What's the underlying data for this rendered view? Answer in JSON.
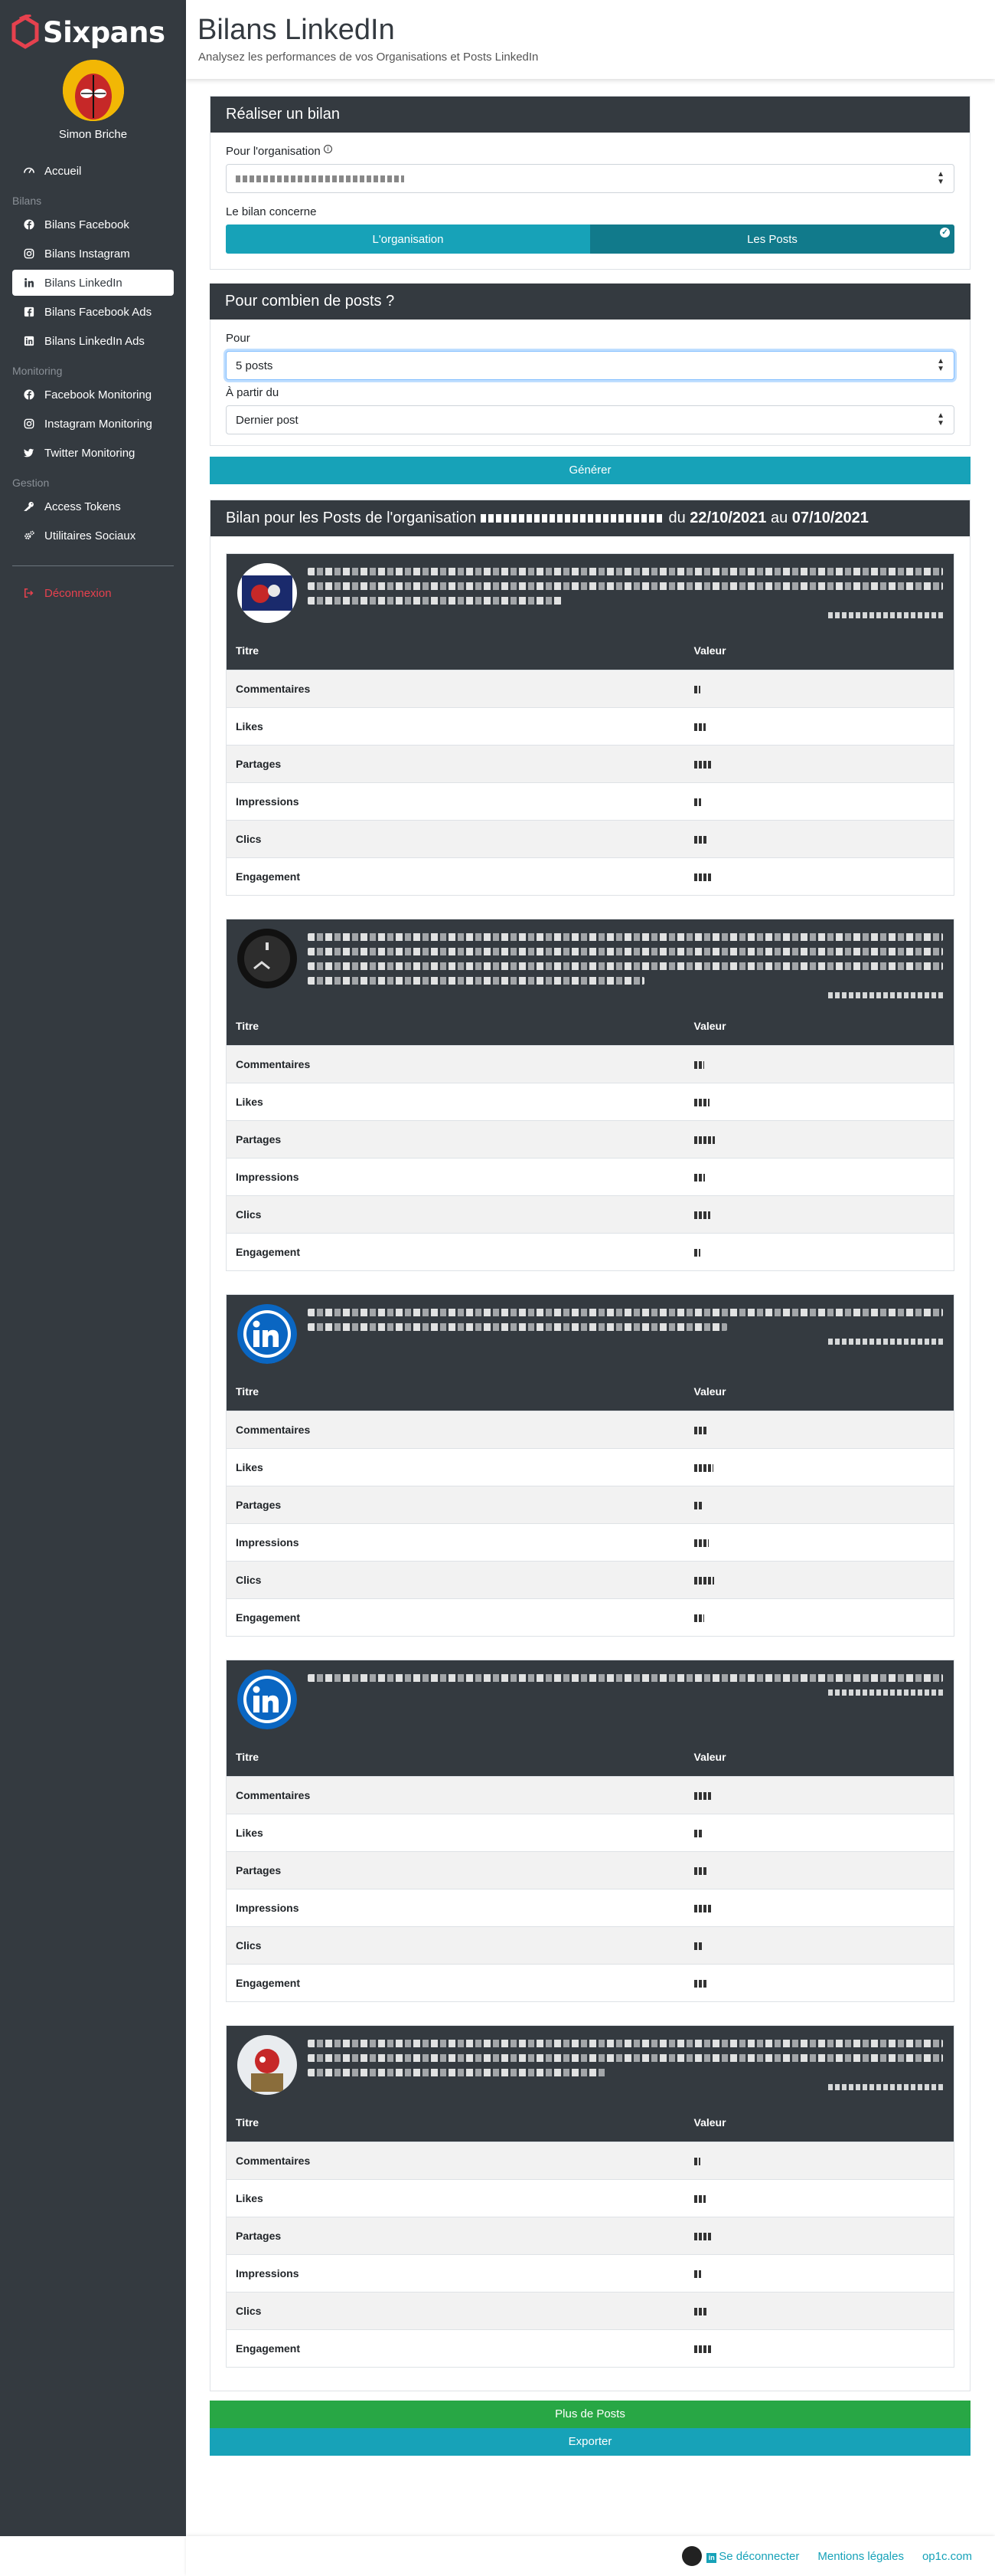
{
  "app": {
    "brand": "Sixpans"
  },
  "user": {
    "name": "Simon Briche"
  },
  "sidebar": {
    "home": "Accueil",
    "section_bilans": "Bilans",
    "bilans": [
      "Bilans Facebook",
      "Bilans Instagram",
      "Bilans LinkedIn",
      "Bilans Facebook Ads",
      "Bilans LinkedIn Ads"
    ],
    "section_monitoring": "Monitoring",
    "monitoring": [
      "Facebook Monitoring",
      "Instagram Monitoring",
      "Twitter Monitoring"
    ],
    "section_gestion": "Gestion",
    "gestion": [
      "Access Tokens",
      "Utilitaires Sociaux"
    ],
    "logout": "Déconnexion"
  },
  "header": {
    "title": "Bilans LinkedIn",
    "subtitle": "Analysez les performances de vos Organisations et Posts LinkedIn"
  },
  "form": {
    "title": "Réaliser un bilan",
    "org_label": "Pour l'organisation",
    "concerns_label": "Le bilan concerne",
    "toggle_org": "L'organisation",
    "toggle_posts": "Les Posts"
  },
  "count": {
    "title": "Pour combien de posts ?",
    "for_label": "Pour",
    "for_value": "5 posts",
    "from_label": "À partir du",
    "from_value": "Dernier post",
    "generate": "Générer"
  },
  "result": {
    "title_prefix": "Bilan pour les Posts de l'organisation",
    "du": "du",
    "date_from": "22/10/2021",
    "au": "au",
    "date_to": "07/10/2021",
    "col_title": "Titre",
    "col_value": "Valeur",
    "rows": [
      "Commentaires",
      "Likes",
      "Partages",
      "Impressions",
      "Clics",
      "Engagement"
    ],
    "more": "Plus de Posts",
    "export": "Exporter"
  },
  "footer": {
    "logout": "Se déconnecter",
    "legal": "Mentions légales",
    "site": "op1c.com"
  }
}
